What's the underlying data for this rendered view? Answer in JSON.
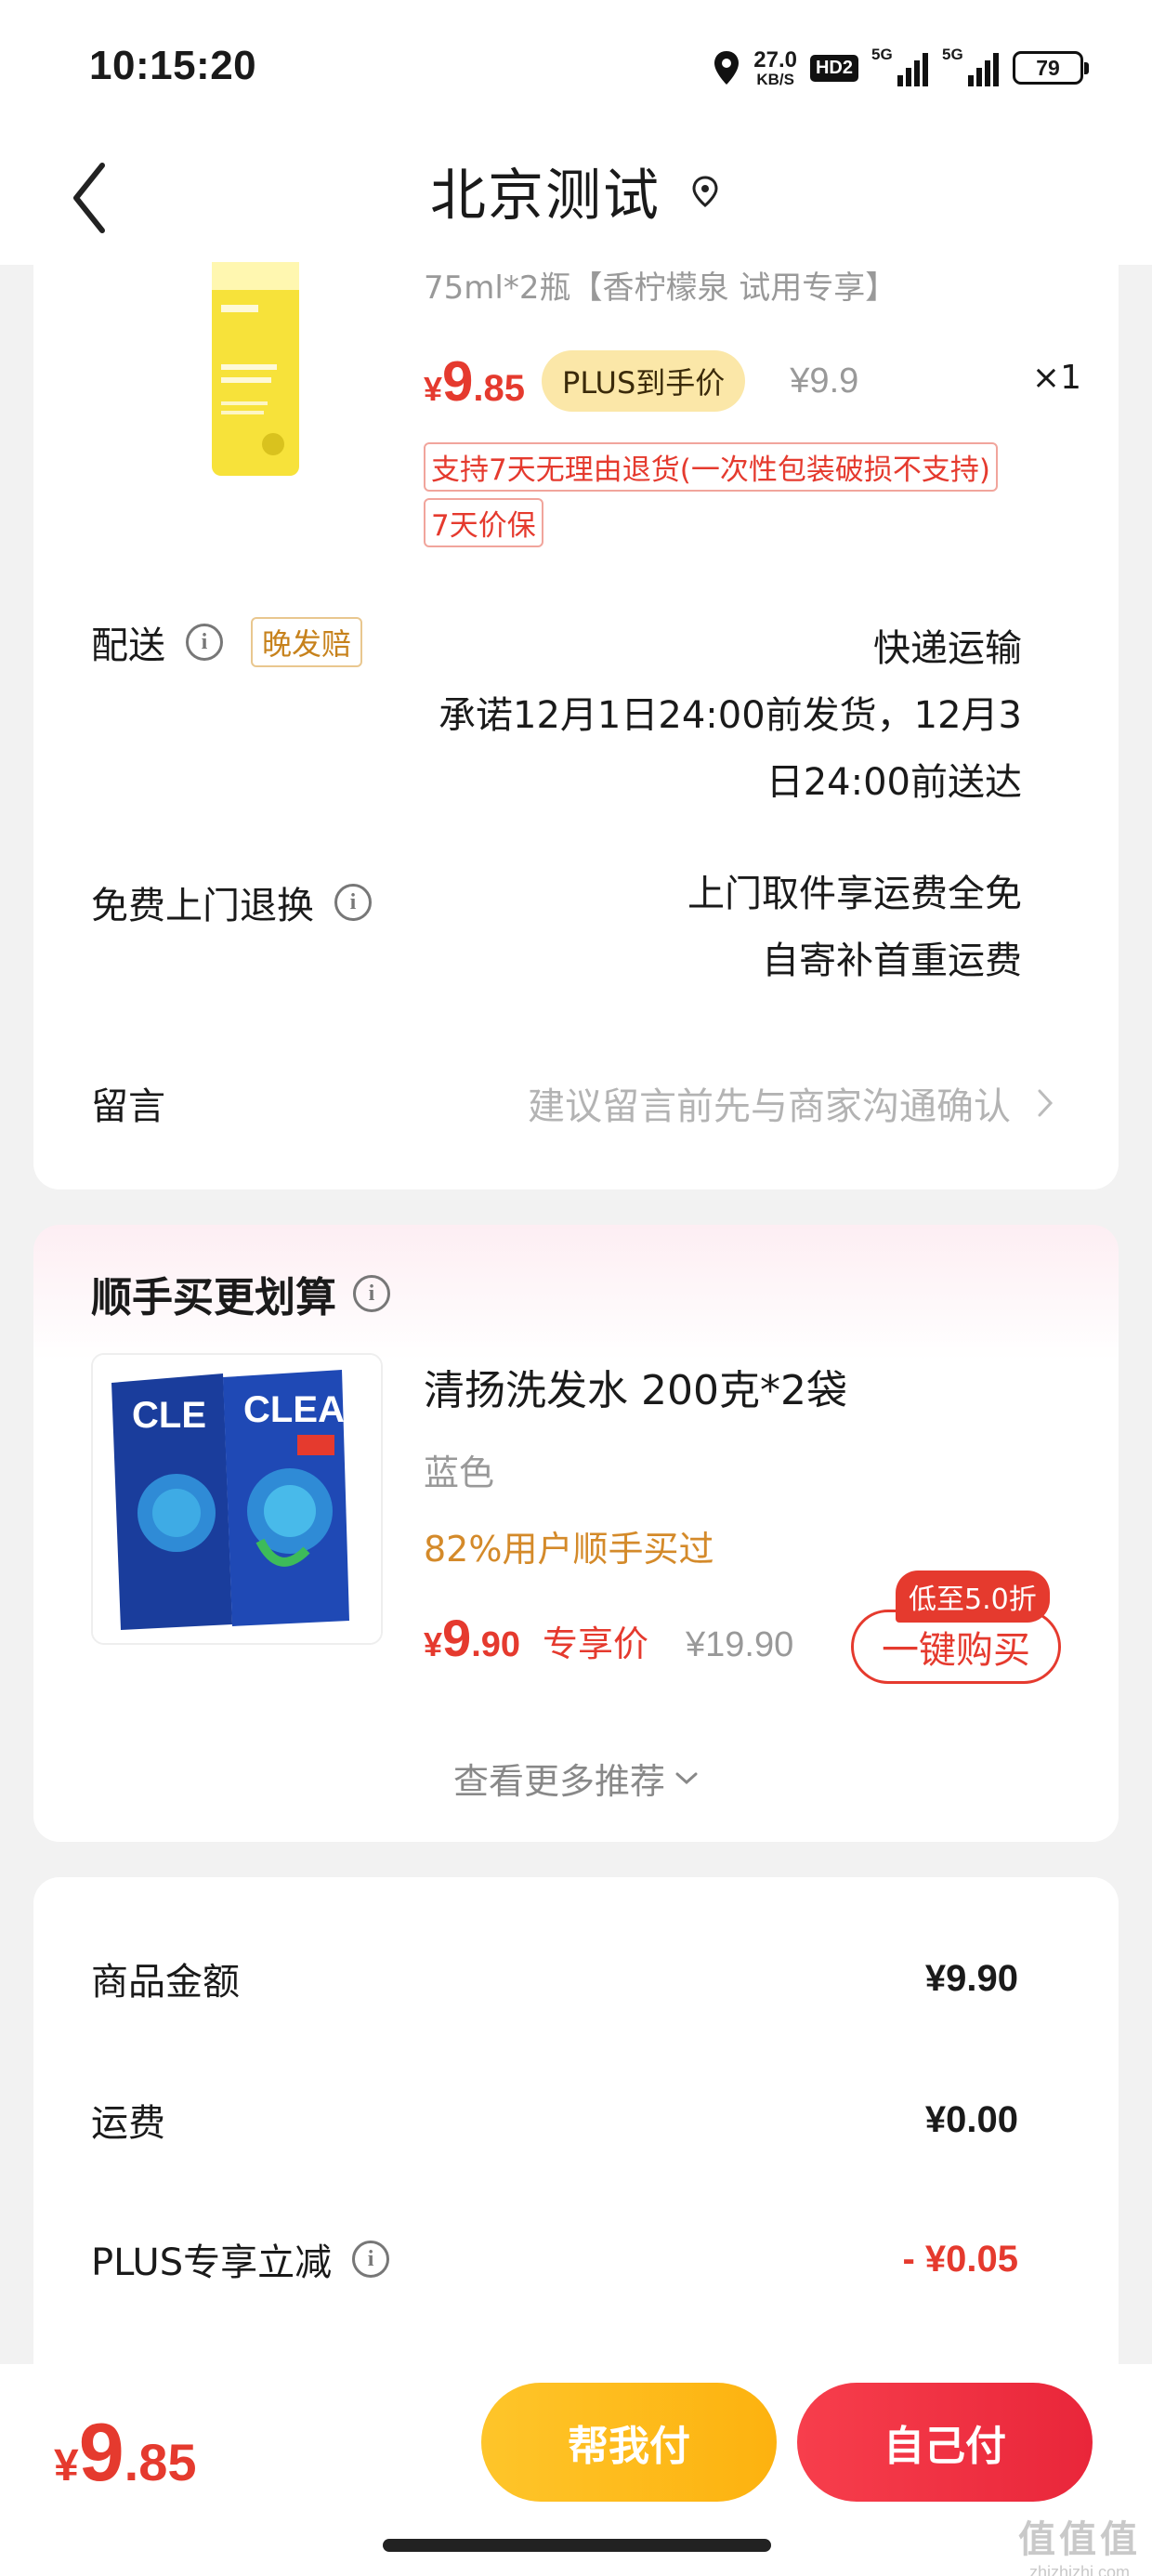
{
  "status_bar": {
    "time": "10:15:20",
    "net_speed_value": "27.0",
    "net_speed_unit": "KB/S",
    "hd_label": "HD2",
    "signal1_label": "5G",
    "signal2_label": "5G",
    "battery": "79"
  },
  "header": {
    "title": "北京测试"
  },
  "product": {
    "spec": "75ml*2瓶【香柠檬泉 试用专享】",
    "price_symbol": "¥",
    "price_int": "9",
    "price_dec": ".85",
    "plus_badge": "PLUS到手价",
    "original_price": "¥9.9",
    "quantity": "×1",
    "tag_return": "支持7天无理由退货(一次性包装破损不支持)",
    "tag_price_protect": "7天价保"
  },
  "delivery": {
    "label": "配送",
    "late_badge": "晚发赔",
    "method": "快递运输",
    "promise_line1": "承诺12月1日24:00前发货，12月3",
    "promise_line2": "日24:00前送达"
  },
  "free_return": {
    "label": "免费上门退换",
    "line1": "上门取件享运费全免",
    "line2": "自寄补首重运费"
  },
  "message": {
    "label": "留言",
    "hint": "建议留言前先与商家沟通确认"
  },
  "recommend": {
    "title": "顺手买更划算",
    "product_name": "清扬洗发水 200克*2袋",
    "color": "蓝色",
    "popularity": "82%用户顺手买过",
    "price_symbol": "¥",
    "price_int": "9",
    "price_dec": ".90",
    "exclusive_label": "专享价",
    "original_price": "¥19.90",
    "discount_tag": "低至5.0折",
    "buy_button": "一键购买",
    "more": "查看更多推荐"
  },
  "summary": {
    "goods_label": "商品金额",
    "goods_amount": "¥9.90",
    "shipping_label": "运费",
    "shipping_amount": "¥0.00",
    "plus_label": "PLUS专享立减",
    "plus_amount": "- ¥0.05"
  },
  "bottom": {
    "total_symbol": "¥",
    "total_int": "9",
    "total_dec": ".85",
    "pay_help": "帮我付",
    "pay_self": "自己付"
  },
  "watermark": {
    "big": "值值值",
    "small": "zhizhizhi.com"
  },
  "colors": {
    "accent_red": "#e53a2e",
    "plus_gold": "#fbe7a8",
    "pay_help_yellow": "#fdb20f",
    "pay_self_red": "#f73e4c"
  }
}
